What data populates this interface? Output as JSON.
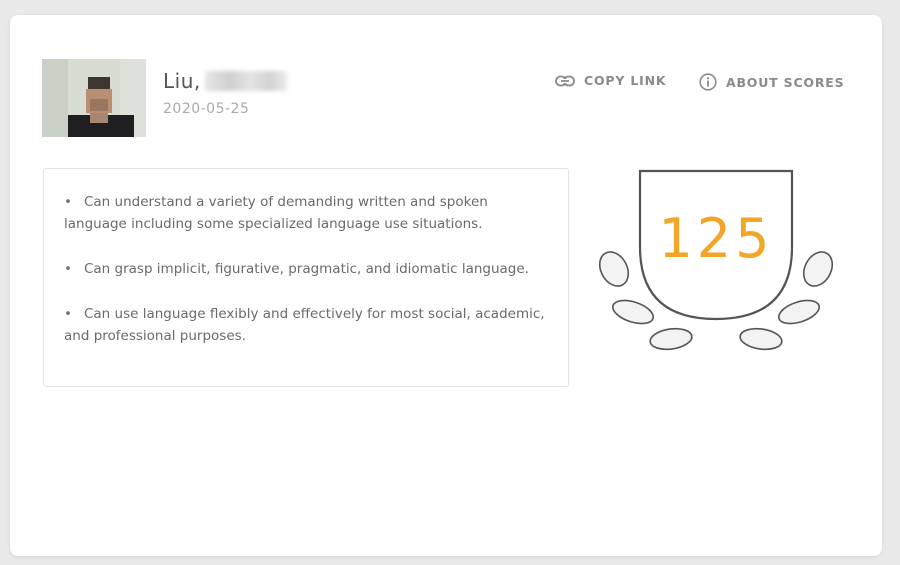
{
  "profile": {
    "name": "Liu,",
    "date": "2020-05-25"
  },
  "actions": {
    "copy_link": "COPY LINK",
    "about_scores": "ABOUT SCORES"
  },
  "descriptions": [
    "Can understand a variety of demanding written and spoken language including some specialized language use situations.",
    "Can grasp implicit, figurative, pragmatic, and idiomatic language.",
    "Can use language flexibly and effectively for most social, academic, and professional purposes."
  ],
  "score": {
    "value": "125",
    "color": "#f2a526"
  },
  "icons": {
    "copy_link": "link-icon",
    "about_scores": "info-icon"
  }
}
